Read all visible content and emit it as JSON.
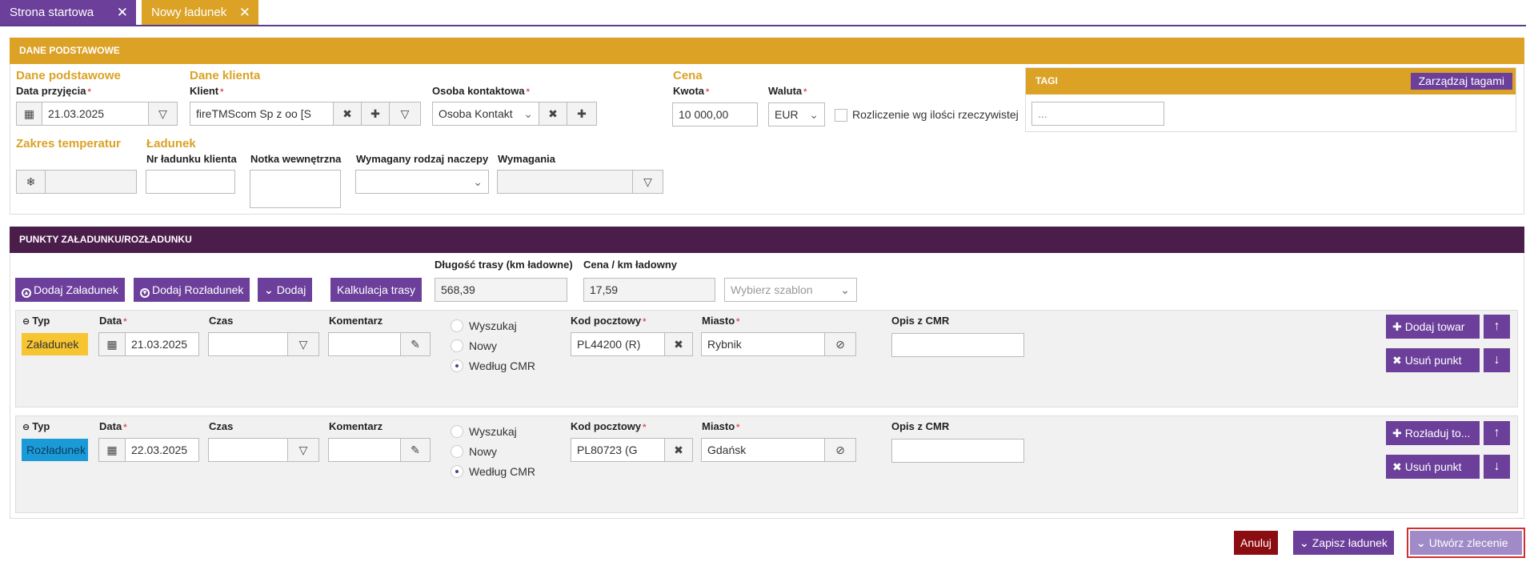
{
  "tabs": [
    {
      "label": "Strona startowa",
      "close": "✕"
    },
    {
      "label": "Nowy ładunek",
      "close": "✕"
    }
  ],
  "basic": {
    "header": "DANE PODSTAWOWE",
    "group_basic": "Dane podstawowe",
    "date_label": "Data przyjęcia",
    "date_value": "21.03.2025",
    "group_client": "Dane klienta",
    "client_label": "Klient",
    "client_value": "fireTMScom Sp z oo [S",
    "contact_label": "Osoba kontaktowa",
    "contact_value": "Osoba Kontakt",
    "group_price": "Cena",
    "amount_label": "Kwota",
    "amount_value": "10 000,00",
    "currency_label": "Waluta",
    "currency_value": "EUR",
    "settle_label": "Rozliczenie wg ilości rzeczywistej",
    "group_temp": "Zakres temperatur",
    "group_load": "Ładunek",
    "client_no_label": "Nr ładunku klienta",
    "note_label": "Notka wewnętrzna",
    "trailer_label": "Wymagany rodzaj naczepy",
    "requirements_label": "Wymagania",
    "tags_header": "TAGI",
    "manage_tags": "Zarządzaj tagami",
    "tags_placeholder": "..."
  },
  "points": {
    "header": "PUNKTY ZAŁADUNKU/ROZŁADUNKU",
    "add_loading": "Dodaj Załadunek",
    "add_unloading": "Dodaj Rozładunek",
    "add": "Dodaj",
    "route_calc": "Kalkulacja trasy",
    "route_length_label": "Długość trasy (km ładowne)",
    "route_length_value": "568,39",
    "price_km_label": "Cena / km ładowny",
    "price_km_value": "17,59",
    "template_placeholder": "Wybierz szablon",
    "labels": {
      "type": "Typ",
      "date": "Data",
      "time": "Czas",
      "comment": "Komentarz",
      "postal": "Kod pocztowy",
      "city": "Miasto",
      "cmr_desc": "Opis z CMR",
      "opt_search": "Wyszukaj",
      "opt_new": "Nowy",
      "opt_cmr": "Według CMR",
      "remove_point": "Usuń punkt"
    },
    "items": [
      {
        "type": "Załadunek",
        "type_color": "#f7c531",
        "date": "21.03.2025",
        "postal": "PL44200 (R)",
        "city": "Rybnik",
        "action": "Dodaj towar"
      },
      {
        "type": "Rozładunek",
        "type_color": "#1a9bd7",
        "date": "22.03.2025",
        "postal": "PL80723 (G",
        "city": "Gdańsk",
        "action": "Rozładuj to..."
      }
    ]
  },
  "footer": {
    "cancel": "Anuluj",
    "save": "Zapisz ładunek",
    "create_order": "Utwórz zlecenie"
  },
  "colors": {
    "accent_gold": "#dba226",
    "accent_purple": "#6b3f9a",
    "header_plum": "#4a1d4a",
    "cancel_red": "#8b0d12"
  }
}
